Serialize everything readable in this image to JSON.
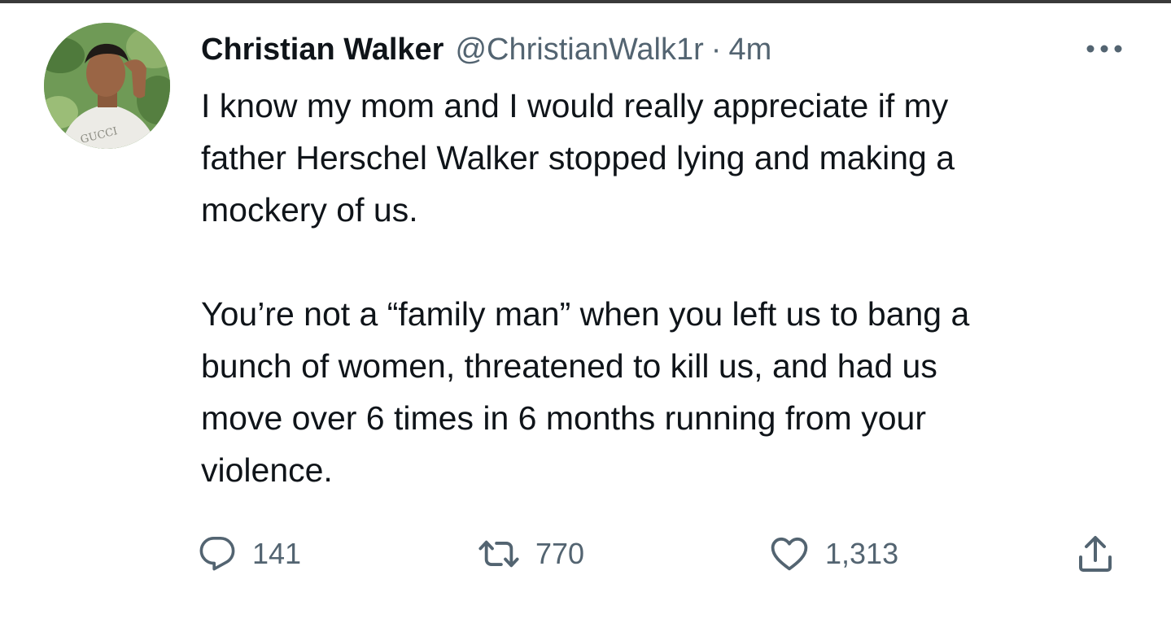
{
  "tweet": {
    "author": {
      "display_name": "Christian Walker",
      "handle": "@ChristianWalk1r",
      "avatar_shirt_text": "GUCCI"
    },
    "separator": "·",
    "time": "4m",
    "text_paragraphs": [
      "I know my mom and I would really appreciate if my\nfather Herschel Walker stopped lying and making a\nmockery of us.",
      "You’re not a “family man” when you left us to bang a\nbunch of women, threatened to kill us, and had us\nmove over 6 times in 6 months running from your\nviolence."
    ],
    "actions": {
      "reply": {
        "icon": "reply-icon",
        "count": "141"
      },
      "retweet": {
        "icon": "retweet-icon",
        "count": "770"
      },
      "like": {
        "icon": "heart-icon",
        "count": "1,313"
      },
      "share": {
        "icon": "share-icon"
      }
    },
    "more_icon": "more-icon"
  },
  "colors": {
    "text_primary": "#0f1419",
    "text_secondary": "#536471",
    "background": "#ffffff"
  }
}
